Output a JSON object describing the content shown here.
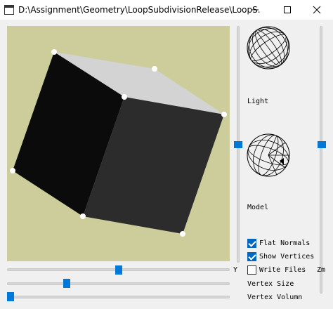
{
  "window": {
    "title": "D:\\Assignment\\Geometry\\LoopSubdivisionRelease\\LoopS...",
    "icons": {
      "app": "app-window-icon",
      "minimize": "minimize-icon",
      "maximize": "maximize-icon",
      "close": "close-icon"
    }
  },
  "viewport": {
    "background_color": "#cdcd9c",
    "shading": "flat",
    "vertices_visible": true
  },
  "panel": {
    "light_label": "Light",
    "model_label": "Model",
    "checkboxes": [
      {
        "label": "Flat Normals",
        "checked": true
      },
      {
        "label": "Show Vertices",
        "checked": true
      },
      {
        "label": "Write Files",
        "checked": false
      }
    ]
  },
  "sliders": {
    "y_label": "Y",
    "zm_label": "Zm",
    "vertex_size_label": "Vertex Size",
    "vertex_volumn_label": "Vertex Volumn",
    "y_value": 0.5,
    "vertex_size_value": 0.26,
    "vertex_volumn_value": 0.0,
    "left_vertical_value": 0.5,
    "zm_value": 0.5
  },
  "accent_color": "#0078d7"
}
